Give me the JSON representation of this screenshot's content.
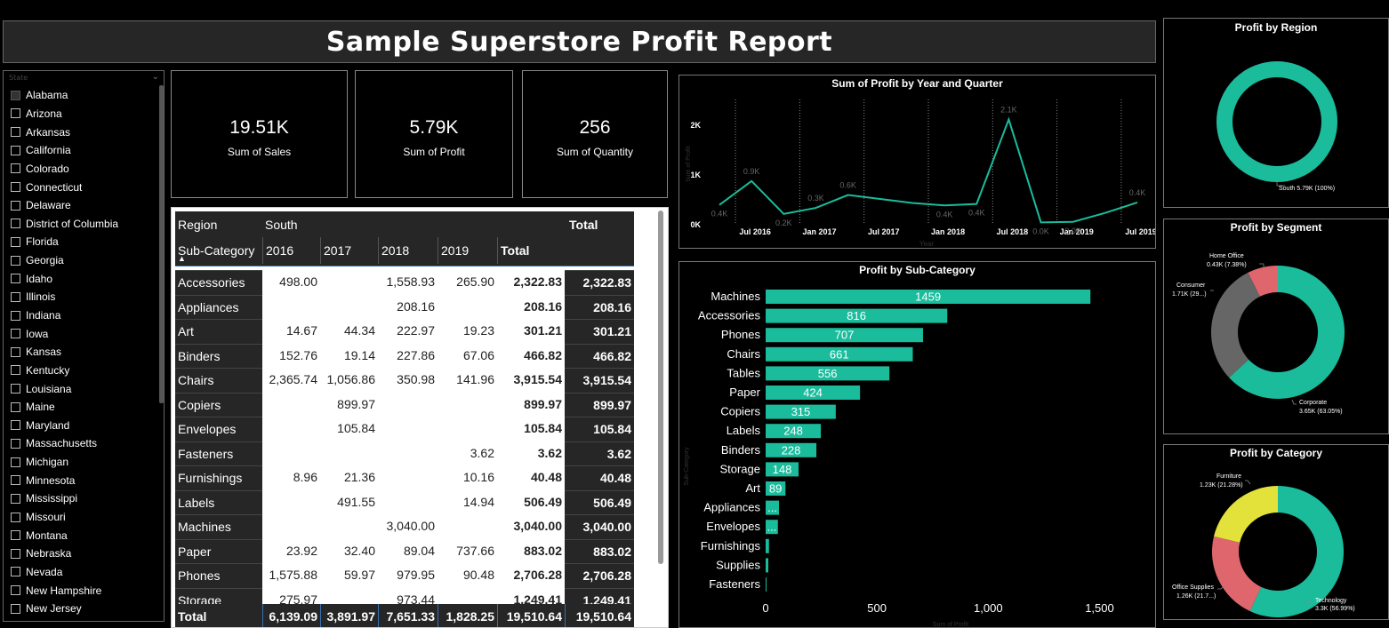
{
  "title": "Sample Superstore Profit Report",
  "slicer": {
    "header": "State",
    "items": [
      {
        "label": "Alabama",
        "checked": true
      },
      {
        "label": "Arizona",
        "checked": false
      },
      {
        "label": "Arkansas",
        "checked": false
      },
      {
        "label": "California",
        "checked": false
      },
      {
        "label": "Colorado",
        "checked": false
      },
      {
        "label": "Connecticut",
        "checked": false
      },
      {
        "label": "Delaware",
        "checked": false
      },
      {
        "label": "District of Columbia",
        "checked": false
      },
      {
        "label": "Florida",
        "checked": false
      },
      {
        "label": "Georgia",
        "checked": false
      },
      {
        "label": "Idaho",
        "checked": false
      },
      {
        "label": "Illinois",
        "checked": false
      },
      {
        "label": "Indiana",
        "checked": false
      },
      {
        "label": "Iowa",
        "checked": false
      },
      {
        "label": "Kansas",
        "checked": false
      },
      {
        "label": "Kentucky",
        "checked": false
      },
      {
        "label": "Louisiana",
        "checked": false
      },
      {
        "label": "Maine",
        "checked": false
      },
      {
        "label": "Maryland",
        "checked": false
      },
      {
        "label": "Massachusetts",
        "checked": false
      },
      {
        "label": "Michigan",
        "checked": false
      },
      {
        "label": "Minnesota",
        "checked": false
      },
      {
        "label": "Mississippi",
        "checked": false
      },
      {
        "label": "Missouri",
        "checked": false
      },
      {
        "label": "Montana",
        "checked": false
      },
      {
        "label": "Nebraska",
        "checked": false
      },
      {
        "label": "Nevada",
        "checked": false
      },
      {
        "label": "New Hampshire",
        "checked": false
      },
      {
        "label": "New Jersey",
        "checked": false
      }
    ]
  },
  "cards": [
    {
      "value": "19.51K",
      "label": "Sum of Sales"
    },
    {
      "value": "5.79K",
      "label": "Sum of Profit"
    },
    {
      "value": "256",
      "label": "Sum of Quantity"
    }
  ],
  "matrix": {
    "region_label": "Region",
    "region_value": "South",
    "total_label": "Total",
    "subcat_label": "Sub-Category",
    "sort_icon": "sort-ascending-icon",
    "years": [
      "2016",
      "2017",
      "2018",
      "2019"
    ],
    "year_total_label": "Total",
    "rows": [
      {
        "name": "Accessories",
        "vals": [
          "498.00",
          "",
          "1,558.93",
          "265.90"
        ],
        "total": "2,322.83",
        "grand": "2,322.83"
      },
      {
        "name": "Appliances",
        "vals": [
          "",
          "",
          "208.16",
          ""
        ],
        "total": "208.16",
        "grand": "208.16"
      },
      {
        "name": "Art",
        "vals": [
          "14.67",
          "44.34",
          "222.97",
          "19.23"
        ],
        "total": "301.21",
        "grand": "301.21"
      },
      {
        "name": "Binders",
        "vals": [
          "152.76",
          "19.14",
          "227.86",
          "67.06"
        ],
        "total": "466.82",
        "grand": "466.82"
      },
      {
        "name": "Chairs",
        "vals": [
          "2,365.74",
          "1,056.86",
          "350.98",
          "141.96"
        ],
        "total": "3,915.54",
        "grand": "3,915.54"
      },
      {
        "name": "Copiers",
        "vals": [
          "",
          "899.97",
          "",
          ""
        ],
        "total": "899.97",
        "grand": "899.97"
      },
      {
        "name": "Envelopes",
        "vals": [
          "",
          "105.84",
          "",
          ""
        ],
        "total": "105.84",
        "grand": "105.84"
      },
      {
        "name": "Fasteners",
        "vals": [
          "",
          "",
          "",
          "3.62"
        ],
        "total": "3.62",
        "grand": "3.62"
      },
      {
        "name": "Furnishings",
        "vals": [
          "8.96",
          "21.36",
          "",
          "10.16"
        ],
        "total": "40.48",
        "grand": "40.48"
      },
      {
        "name": "Labels",
        "vals": [
          "",
          "491.55",
          "",
          "14.94"
        ],
        "total": "506.49",
        "grand": "506.49"
      },
      {
        "name": "Machines",
        "vals": [
          "",
          "",
          "3,040.00",
          ""
        ],
        "total": "3,040.00",
        "grand": "3,040.00"
      },
      {
        "name": "Paper",
        "vals": [
          "23.92",
          "32.40",
          "89.04",
          "737.66"
        ],
        "total": "883.02",
        "grand": "883.02"
      },
      {
        "name": "Phones",
        "vals": [
          "1,575.88",
          "59.97",
          "979.95",
          "90.48"
        ],
        "total": "2,706.28",
        "grand": "2,706.28"
      },
      {
        "name": "Storage",
        "vals": [
          "275.97",
          "",
          "973.44",
          ""
        ],
        "total": "1,249.41",
        "grand": "1,249.41"
      }
    ],
    "footer": {
      "name": "Total",
      "vals": [
        "6,139.09",
        "3,891.97",
        "7,651.33",
        "1,828.25"
      ],
      "total": "19,510.64",
      "grand": "19,510.64"
    }
  },
  "colors": {
    "teal": "#1ABC9C",
    "grey": "#666666",
    "red": "#E0666E",
    "yellow": "#E2E23A",
    "panel": "#262626"
  },
  "chart_data": [
    {
      "type": "line",
      "title": "Sum of Profit by Year and Quarter",
      "xlabel": "Year",
      "ylabel": "Sum of Profit",
      "x": [
        "2016 Q2",
        "2016 Q3",
        "2016 Q4",
        "2017 Q1",
        "2017 Q2",
        "2017 Q3",
        "2017 Q4",
        "2018 Q1",
        "2018 Q2",
        "2018 Q3",
        "2018 Q4",
        "2019 Q1",
        "2019 Q2",
        "2019 Q3"
      ],
      "values": [
        0.38,
        0.86,
        0.2,
        0.32,
        0.58,
        0.5,
        0.42,
        0.37,
        0.4,
        2.1,
        0.03,
        0.04,
        0.22,
        0.43
      ],
      "data_labels": [
        "0.4K",
        "0.9K",
        "0.2K",
        "0.3K",
        "0.6K",
        "",
        "",
        "0.4K",
        "0.4K",
        "2.1K",
        "0.0K",
        "0.0K",
        "",
        "0.4K"
      ],
      "x_ticks": [
        "Jul 2016",
        "Jan 2017",
        "Jul 2017",
        "Jan 2018",
        "Jul 2018",
        "Jan 2019",
        "Jul 2019"
      ],
      "y_ticks": [
        "0K",
        "1K",
        "2K"
      ],
      "ylim": [
        0,
        2.5
      ],
      "grid": "vertical dotted"
    },
    {
      "type": "bar",
      "orientation": "horizontal",
      "title": "Profit by Sub-Category",
      "ylabel": "Sub-Category",
      "xlabel": "Sum of Profit",
      "categories": [
        "Machines",
        "Accessories",
        "Phones",
        "Chairs",
        "Tables",
        "Paper",
        "Copiers",
        "Labels",
        "Binders",
        "Storage",
        "Art",
        "Appliances",
        "Envelopes",
        "Furnishings",
        "Supplies",
        "Fasteners"
      ],
      "values": [
        1459,
        816,
        707,
        661,
        556,
        424,
        315,
        248,
        228,
        148,
        89,
        60,
        55,
        15,
        12,
        4
      ],
      "data_labels": [
        "1459",
        "816",
        "707",
        "661",
        "556",
        "424",
        "315",
        "248",
        "228",
        "148",
        "89",
        "...",
        "...",
        "",
        "",
        ""
      ],
      "x_ticks": [
        "0",
        "500",
        "1,000",
        "1,500"
      ],
      "xlim": [
        0,
        1550
      ]
    },
    {
      "type": "pie",
      "variant": "donut",
      "title": "Profit by Region",
      "slices": [
        {
          "name": "South",
          "value": 5.79,
          "label": "South 5.79K (100%)",
          "color": "#1ABC9C"
        }
      ]
    },
    {
      "type": "pie",
      "variant": "donut",
      "title": "Profit by Segment",
      "slices": [
        {
          "name": "Corporate",
          "value": 63.05,
          "label_top": "Corporate",
          "label_bottom": "3.65K (63.05%)",
          "color": "#1ABC9C"
        },
        {
          "name": "Consumer",
          "value": 29.57,
          "label_top": "Consumer",
          "label_bottom": "1.71K (29...)",
          "color": "#666666"
        },
        {
          "name": "Home Office",
          "value": 7.38,
          "label_top": "Home Office",
          "label_bottom": "0.43K (7.38%)",
          "color": "#E0666E"
        }
      ]
    },
    {
      "type": "pie",
      "variant": "donut",
      "title": "Profit by Category",
      "slices": [
        {
          "name": "Technology",
          "value": 56.99,
          "label_top": "Technology",
          "label_bottom": "3.3K (56.99%)",
          "color": "#1ABC9C"
        },
        {
          "name": "Office Supplies",
          "value": 21.73,
          "label_top": "Office Supplies",
          "label_bottom": "1.26K (21.7...)",
          "color": "#E0666E"
        },
        {
          "name": "Furniture",
          "value": 21.28,
          "label_top": "Furniture",
          "label_bottom": "1.23K (21.28%)",
          "color": "#E2E23A"
        }
      ]
    }
  ]
}
